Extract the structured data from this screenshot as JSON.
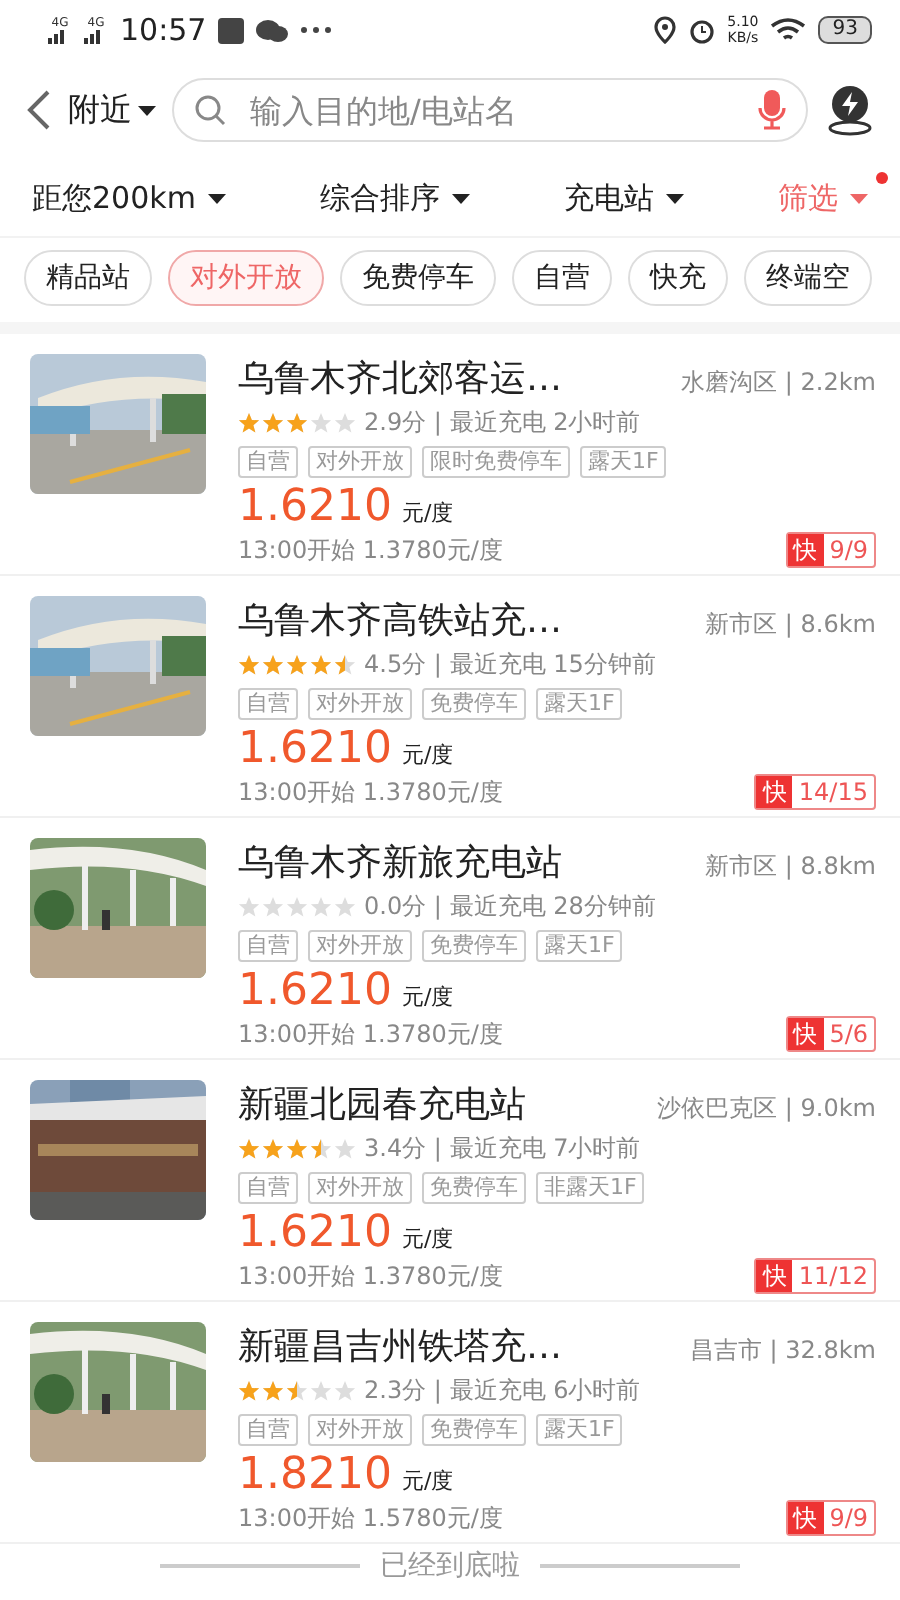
{
  "status_bar": {
    "network_1": "4G",
    "network_2": "4G",
    "time": "10:57",
    "speed": "5.10",
    "speed_unit": "KB/s",
    "battery": "93"
  },
  "header": {
    "location": "附近",
    "search": {
      "placeholder": "输入目的地/电站名"
    }
  },
  "filters": [
    {
      "label": "距您200km",
      "selected": false
    },
    {
      "label": "综合排序",
      "selected": false
    },
    {
      "label": "充电站",
      "selected": false
    },
    {
      "label": "筛选",
      "selected": true
    }
  ],
  "chips": [
    {
      "label": "精品站",
      "selected": false
    },
    {
      "label": "对外开放",
      "selected": true
    },
    {
      "label": "免费停车",
      "selected": false
    },
    {
      "label": "自营",
      "selected": false
    },
    {
      "label": "快充",
      "selected": false
    },
    {
      "label": "终端空",
      "selected": false
    }
  ],
  "stations": [
    {
      "name": "乌鲁木齐北郊客运…",
      "area": "水磨沟区 | 2.2km",
      "stars": 3,
      "score": "2.9分 | 最近充电 2小时前",
      "tags": [
        "自营",
        "对外开放",
        "限时免费停车",
        "露天1F"
      ],
      "price": "1.6210",
      "unit": "元/度",
      "later": "13:00开始 1.3780元/度",
      "badge": "快",
      "count": "9/9"
    },
    {
      "name": "乌鲁木齐高铁站充…",
      "area": "新市区 | 8.6km",
      "stars": 4.5,
      "score": "4.5分 | 最近充电 15分钟前",
      "tags": [
        "自营",
        "对外开放",
        "免费停车",
        "露天1F"
      ],
      "price": "1.6210",
      "unit": "元/度",
      "later": "13:00开始 1.3780元/度",
      "badge": "快",
      "count": "14/15"
    },
    {
      "name": "乌鲁木齐新旅充电站",
      "area": "新市区 | 8.8km",
      "stars": 0,
      "score": "0.0分 | 最近充电 28分钟前",
      "tags": [
        "自营",
        "对外开放",
        "免费停车",
        "露天1F"
      ],
      "price": "1.6210",
      "unit": "元/度",
      "later": "13:00开始 1.3780元/度",
      "badge": "快",
      "count": "5/6"
    },
    {
      "name": "新疆北园春充电站",
      "area": "沙依巴克区 | 9.0km",
      "stars": 3.5,
      "score": "3.4分 | 最近充电 7小时前",
      "tags": [
        "自营",
        "对外开放",
        "免费停车",
        "非露天1F"
      ],
      "price": "1.6210",
      "unit": "元/度",
      "later": "13:00开始 1.3780元/度",
      "badge": "快",
      "count": "11/12"
    },
    {
      "name": "新疆昌吉州铁塔充…",
      "area": "昌吉市 | 32.8km",
      "stars": 2.5,
      "score": "2.3分 | 最近充电 6小时前",
      "tags": [
        "自营",
        "对外开放",
        "免费停车",
        "露天1F"
      ],
      "price": "1.8210",
      "unit": "元/度",
      "later": "13:00开始 1.5780元/度",
      "badge": "快",
      "count": "9/9"
    }
  ],
  "footer": "已经到底啦"
}
